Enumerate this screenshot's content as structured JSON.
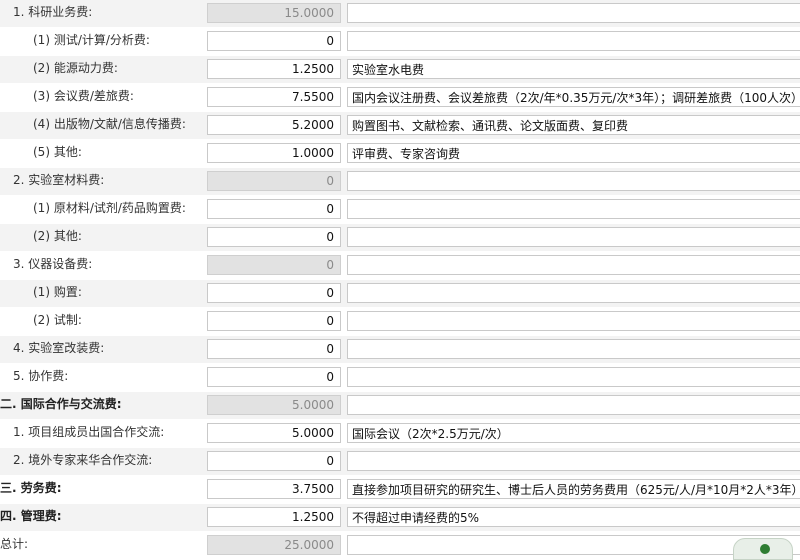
{
  "rows": [
    {
      "label": "1. 科研业务费:",
      "amount": "15.0000",
      "desc": "",
      "disabled": true
    },
    {
      "label": "(1) 测试/计算/分析费:",
      "amount": "0",
      "desc": "",
      "disabled": false
    },
    {
      "label": "(2) 能源动力费:",
      "amount": "1.2500",
      "desc": "实验室水电费",
      "disabled": false
    },
    {
      "label": "(3) 会议费/差旅费:",
      "amount": "7.5500",
      "desc": "国内会议注册费、会议差旅费（2次/年*0.35万元/次*3年）；调研差旅费（100人次）",
      "disabled": false
    },
    {
      "label": "(4) 出版物/文献/信息传播费:",
      "amount": "5.2000",
      "desc": "购置图书、文献检索、通讯费、论文版面费、复印费",
      "disabled": false
    },
    {
      "label": "(5) 其他:",
      "amount": "1.0000",
      "desc": "评审费、专家咨询费",
      "disabled": false
    },
    {
      "label": "2. 实验室材料费:",
      "amount": "0",
      "desc": "",
      "disabled": true
    },
    {
      "label": "(1) 原材料/试剂/药品购置费:",
      "amount": "0",
      "desc": "",
      "disabled": false
    },
    {
      "label": "(2) 其他:",
      "amount": "0",
      "desc": "",
      "disabled": false
    },
    {
      "label": "3. 仪器设备费:",
      "amount": "0",
      "desc": "",
      "disabled": true
    },
    {
      "label": "(1) 购置:",
      "amount": "0",
      "desc": "",
      "disabled": false
    },
    {
      "label": "(2) 试制:",
      "amount": "0",
      "desc": "",
      "disabled": false
    },
    {
      "label": "4. 实验室改装费:",
      "amount": "0",
      "desc": "",
      "disabled": false
    },
    {
      "label": "5. 协作费:",
      "amount": "0",
      "desc": "",
      "disabled": false
    },
    {
      "label": "二. 国际合作与交流费:",
      "amount": "5.0000",
      "desc": "",
      "disabled": true
    },
    {
      "label": "1. 项目组成员出国合作交流:",
      "amount": "5.0000",
      "desc": "国际会议（2次*2.5万元/次）",
      "disabled": false
    },
    {
      "label": "2. 境外专家来华合作交流:",
      "amount": "0",
      "desc": "",
      "disabled": false
    },
    {
      "label": "三. 劳务费:",
      "amount": "3.7500",
      "desc": "直接参加项目研究的研究生、博士后人员的劳务费用（625元/人/月*10月*2人*3年）",
      "disabled": false
    },
    {
      "label": "四. 管理费:",
      "amount": "1.2500",
      "desc": "不得超过申请经费的5%",
      "disabled": false
    },
    {
      "label": "总计:",
      "amount": "25.0000",
      "desc": "",
      "disabled": true
    }
  ]
}
